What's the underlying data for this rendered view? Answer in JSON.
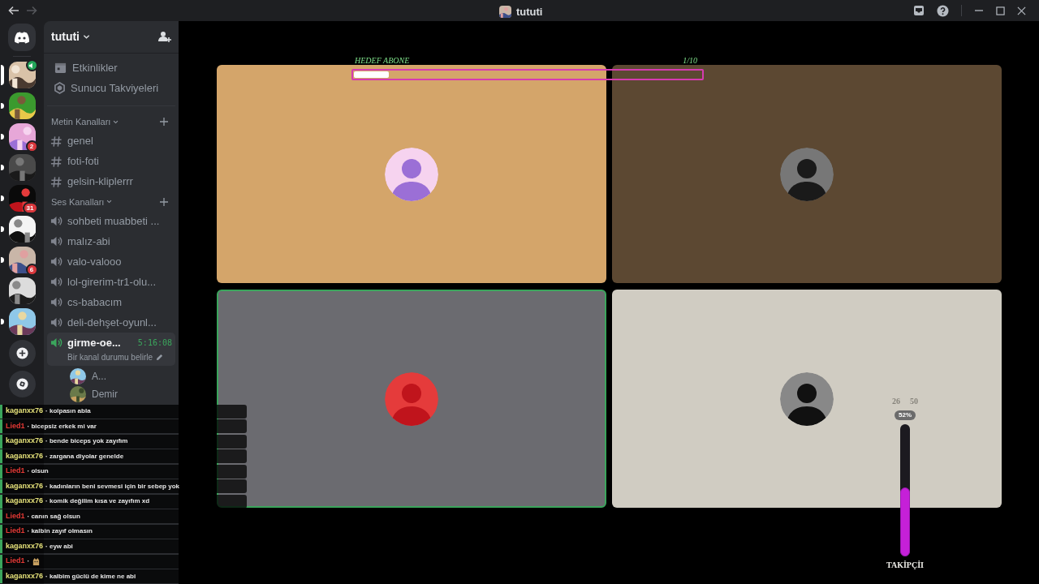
{
  "window": {
    "title": "tututi"
  },
  "servers": [
    {
      "selected": true,
      "unread": false,
      "voice": true
    },
    {
      "selected": false,
      "unread": true,
      "voice": false
    },
    {
      "selected": false,
      "unread": true,
      "voice": false,
      "badge": "2"
    },
    {
      "selected": false,
      "unread": true,
      "voice": false
    },
    {
      "selected": false,
      "unread": true,
      "voice": false,
      "badge": "31"
    },
    {
      "selected": false,
      "unread": true,
      "voice": false
    },
    {
      "selected": false,
      "unread": true,
      "voice": false,
      "badge": "6"
    },
    {
      "selected": false,
      "unread": false,
      "voice": false
    },
    {
      "selected": false,
      "unread": true,
      "voice": false
    }
  ],
  "sidebar": {
    "title": "tututi",
    "links": [
      {
        "kind": "calendar",
        "label": "Etkinlikler"
      },
      {
        "kind": "boost",
        "label": "Sunucu Takviyeleri"
      }
    ],
    "categories": [
      {
        "title": "Metin Kanalları",
        "channels": [
          {
            "kind": "text",
            "name": "genel",
            "selected": false
          },
          {
            "kind": "text",
            "name": "foti-foti",
            "selected": false
          },
          {
            "kind": "text",
            "name": "gelsin-kliplerrr",
            "selected": false
          }
        ]
      },
      {
        "title": "Ses Kanalları",
        "channels": [
          {
            "kind": "voice",
            "name": "sohbeti muabbeti ...",
            "selected": false
          },
          {
            "kind": "voice",
            "name": "malız-abi",
            "selected": false
          },
          {
            "kind": "voice",
            "name": "valo-valooo",
            "selected": false
          },
          {
            "kind": "voice",
            "name": "lol-girerim-tr1-olu...",
            "selected": false
          },
          {
            "kind": "voice",
            "name": "cs-babacım",
            "selected": false
          },
          {
            "kind": "voice",
            "name": "deli-dehşet-oyunl...",
            "selected": false
          },
          {
            "kind": "voice",
            "name": "girme-oe...",
            "selected": true,
            "timer": "5:16:08",
            "status": "Bir kanal durumu belirle",
            "members": [
              {
                "name": "A..."
              },
              {
                "name": "Demir"
              }
            ]
          }
        ]
      }
    ]
  },
  "stage": {
    "goal": {
      "title": "HEDEF ABONE",
      "count": "1/10",
      "level": 0.1
    },
    "tiles": [
      {
        "color": "#d4a56a",
        "speaking": false
      },
      {
        "color": "#5c4832",
        "speaking": false
      },
      {
        "color": "#6b6b70",
        "speaking": true
      },
      {
        "color": "#d0ccc2",
        "speaking": false
      }
    ],
    "meter": {
      "current": "26",
      "target": "50",
      "reading": "52%",
      "level": 0.52,
      "label": "TAKİPÇİI"
    }
  },
  "chat": [
    {
      "kind": "text",
      "user": "kaganxx76",
      "color": "#e6e27a",
      "text": "· kolpasın abla"
    },
    {
      "kind": "text",
      "user": "Lied1",
      "color": "#e53935",
      "text": "· bicepsiz erkek mi var"
    },
    {
      "kind": "text",
      "user": "kaganxx76",
      "color": "#e6e27a",
      "text": "· bende biceps yok zayıfım"
    },
    {
      "kind": "text",
      "user": "kaganxx76",
      "color": "#e6e27a",
      "text": "· zargana diyolar genelde"
    },
    {
      "kind": "text",
      "user": "Lied1",
      "color": "#e53935",
      "text": "· olsun"
    },
    {
      "kind": "text",
      "user": "kaganxx76",
      "color": "#e6e27a",
      "text": "· kadınların beni sevmesi için bir sebep yok"
    },
    {
      "kind": "text",
      "user": "kaganxx76",
      "color": "#e6e27a",
      "text": "· komik değilim kısa ve zayıfım xd"
    },
    {
      "kind": "text",
      "user": "Lied1",
      "color": "#e53935",
      "text": "· canın sağ olsun"
    },
    {
      "kind": "text",
      "user": "Lied1",
      "color": "#e53935",
      "text": "· kalbin zayıf olmasın"
    },
    {
      "kind": "text",
      "user": "kaganxx76",
      "color": "#e6e27a",
      "text": "· eyw abi"
    },
    {
      "kind": "emote",
      "user": "Lied1",
      "color": "#e53935",
      "text": "·"
    },
    {
      "kind": "text",
      "user": "kaganxx76",
      "color": "#e6e27a",
      "text": "· kalbim güclü de kime ne abi"
    }
  ]
}
